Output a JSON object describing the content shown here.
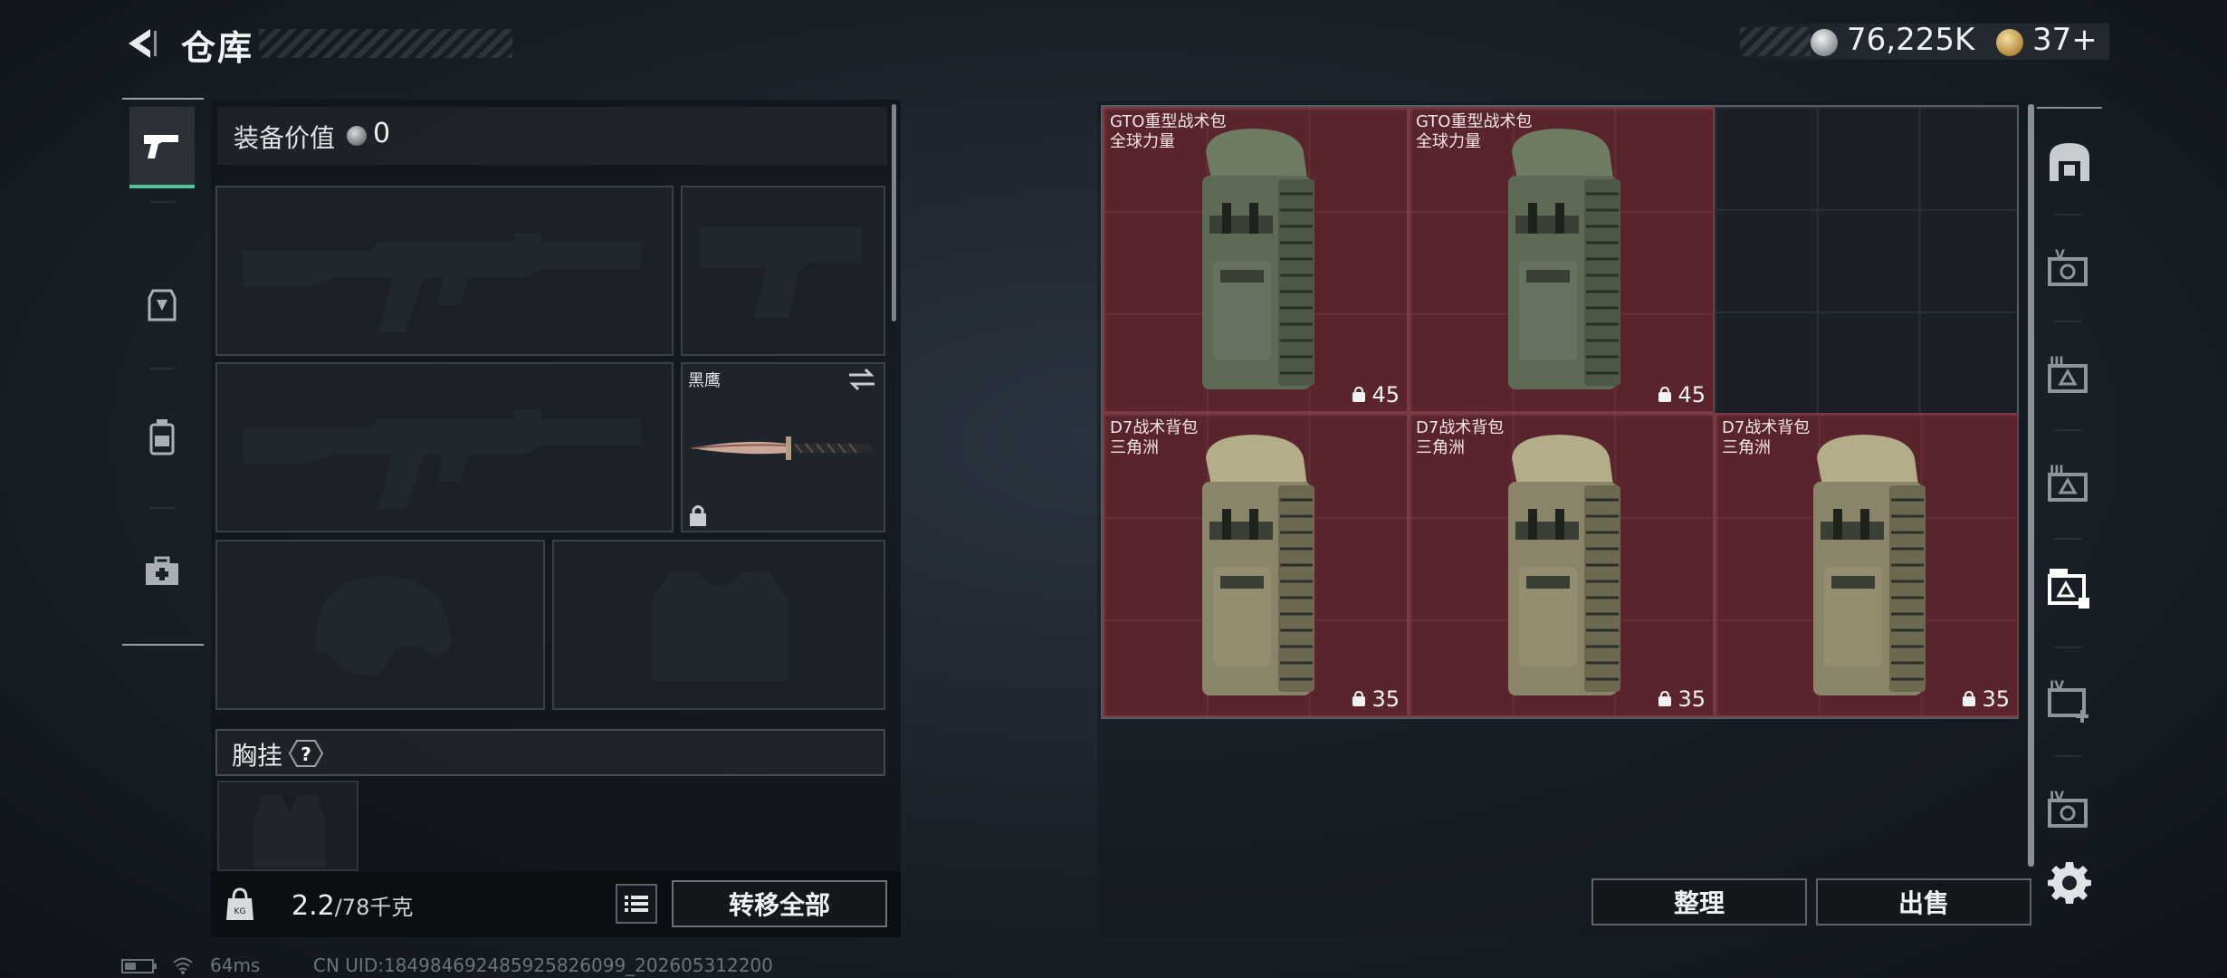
{
  "header": {
    "title": "仓库",
    "currency_silver": "76,225K",
    "currency_gold": "37+"
  },
  "left_tabs": [
    {
      "name": "weapons",
      "icon": "pistol-icon",
      "active": true
    },
    {
      "name": "equipment",
      "icon": "armor-rig-icon",
      "active": false
    },
    {
      "name": "backpack",
      "icon": "backpack-icon",
      "active": false
    },
    {
      "name": "items",
      "icon": "medkit-icon",
      "active": false
    }
  ],
  "equipment": {
    "value_label": "装备价值",
    "value": "0",
    "knife_name": "黑鹰",
    "chest_label": "胸挂",
    "chest_help": "?",
    "weight_value": "2.2",
    "weight_cap": "/78千克",
    "transfer_all": "转移全部"
  },
  "storage": {
    "items": [
      {
        "name": "GTO重型战术包",
        "subtitle": "全球力量",
        "capacity": "45"
      },
      {
        "name": "GTO重型战术包",
        "subtitle": "全球力量",
        "capacity": "45"
      },
      {
        "name": "D7战术背包",
        "subtitle": "三角洲",
        "capacity": "35"
      },
      {
        "name": "D7战术背包",
        "subtitle": "三角洲",
        "capacity": "35"
      },
      {
        "name": "D7战术背包",
        "subtitle": "三角洲",
        "capacity": "35"
      }
    ],
    "sort_label": "整理",
    "sell_label": "出售"
  },
  "right_rail": [
    "vault-door-icon",
    "storage-v-icon",
    "storage-iii-a-icon",
    "storage-iii-b-icon",
    "storage-active-icon",
    "storage-iv-add-icon",
    "storage-iv-icon",
    "settings-gear-icon"
  ],
  "footer": {
    "ping": "64ms",
    "uid": "CN UID:1849846924859258260​99_202605312200"
  },
  "colors": {
    "item_bg": "#5a242c",
    "active_tab": "#53c49a"
  }
}
